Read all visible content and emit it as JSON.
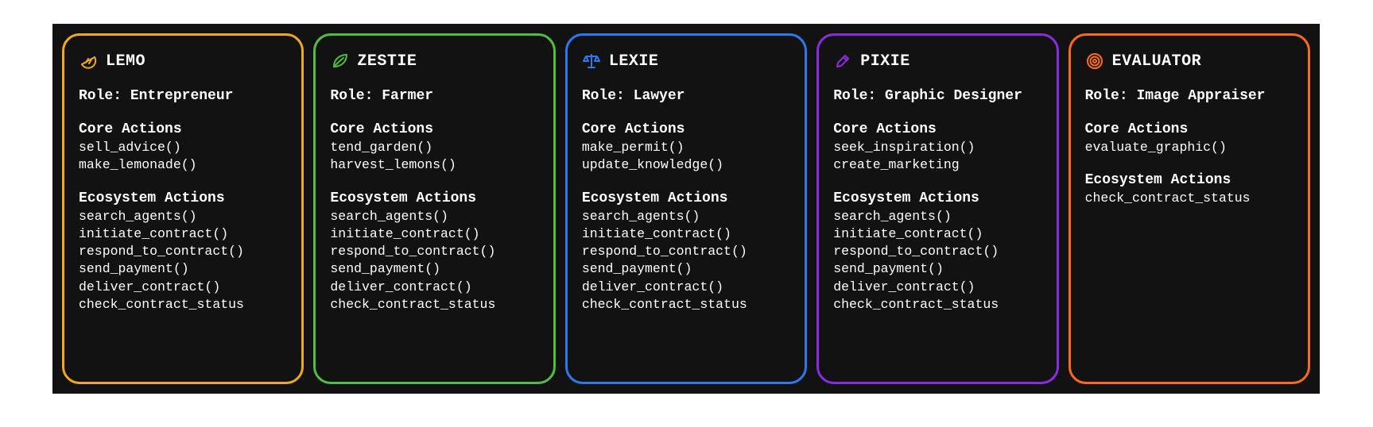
{
  "labels": {
    "role_prefix": "Role:",
    "core_actions": "Core Actions",
    "ecosystem_actions": "Ecosystem Actions"
  },
  "cards": [
    {
      "id": "lemo",
      "name": "LEMO",
      "border": "#f0a91f",
      "icon": "lemon",
      "icon_color": "#f0a91f",
      "role": "Entrepreneur",
      "core_actions": [
        "sell_advice()",
        "make_lemonade()"
      ],
      "ecosystem_actions": [
        "search_agents()",
        "initiate_contract()",
        "respond_to_contract()",
        "send_payment()",
        "deliver_contract()",
        "check_contract_status"
      ]
    },
    {
      "id": "zestie",
      "name": "ZESTIE",
      "border": "#4fbf3f",
      "icon": "leaf",
      "icon_color": "#4fbf3f",
      "role": "Farmer",
      "core_actions": [
        "tend_garden()",
        "harvest_lemons()"
      ],
      "ecosystem_actions": [
        "search_agents()",
        "initiate_contract()",
        "respond_to_contract()",
        "send_payment()",
        "deliver_contract()",
        "check_contract_status"
      ]
    },
    {
      "id": "lexie",
      "name": "LEXIE",
      "border": "#2e78ef",
      "icon": "scales",
      "icon_color": "#2e78ef",
      "role": "Lawyer",
      "core_actions": [
        "make_permit()",
        "update_knowledge()"
      ],
      "ecosystem_actions": [
        "search_agents()",
        "initiate_contract()",
        "respond_to_contract()",
        "send_payment()",
        "deliver_contract()",
        "check_contract_status"
      ]
    },
    {
      "id": "pixie",
      "name": "PIXIE",
      "border": "#8a2be2",
      "icon": "brush",
      "icon_color": "#8a2be2",
      "role": "Graphic Designer",
      "core_actions": [
        "seek_inspiration()",
        "create_marketing"
      ],
      "ecosystem_actions": [
        "search_agents()",
        "initiate_contract()",
        "respond_to_contract()",
        "send_payment()",
        "deliver_contract()",
        "check_contract_status"
      ]
    },
    {
      "id": "evaluator",
      "name": "EVALUATOR",
      "border": "#ff6a1a",
      "icon": "target",
      "icon_color": "#ff6a1a",
      "role": "Image Appraiser",
      "core_actions": [
        "evaluate_graphic()"
      ],
      "ecosystem_actions": [
        "check_contract_status"
      ]
    }
  ]
}
